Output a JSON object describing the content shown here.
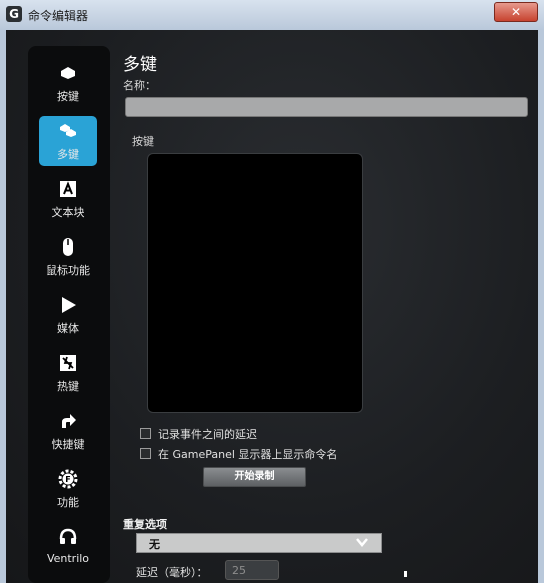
{
  "window": {
    "title": "命令编辑器",
    "app_icon_glyph": "G",
    "close_glyph": "✕"
  },
  "sidebar": {
    "items": [
      {
        "label": "按键",
        "icon": "key-icon",
        "active": false
      },
      {
        "label": "多键",
        "icon": "multikey-icon",
        "active": true
      },
      {
        "label": "文本块",
        "icon": "text-block-icon",
        "active": false
      },
      {
        "label": "鼠标功能",
        "icon": "mouse-icon",
        "active": false
      },
      {
        "label": "媒体",
        "icon": "play-icon",
        "active": false
      },
      {
        "label": "热键",
        "icon": "hotkey-icon",
        "active": false
      },
      {
        "label": "快捷键",
        "icon": "shortcut-arrow-icon",
        "active": false
      },
      {
        "label": "功能",
        "icon": "function-gear-icon",
        "active": false
      },
      {
        "label": "Ventrilo",
        "icon": "ventrilo-headset-icon",
        "active": false
      }
    ]
  },
  "main": {
    "title": "多键",
    "name_label": "名称：",
    "name_value": "",
    "keys_label": "按键",
    "checkbox_delay_label": "记录事件之间的延迟",
    "checkbox_delay_checked": false,
    "checkbox_gamepanel_label": "在 GamePanel 显示器上显示命令名",
    "checkbox_gamepanel_checked": false,
    "record_button_label": "开始录制",
    "repeat_label": "重复选项",
    "repeat_value": "无",
    "delay_label": "延迟（毫秒）：",
    "delay_value": "25"
  },
  "colors": {
    "accent": "#2aa3d6",
    "sidebar_bg": "#0b0c0d",
    "background": "#1c1e21"
  }
}
